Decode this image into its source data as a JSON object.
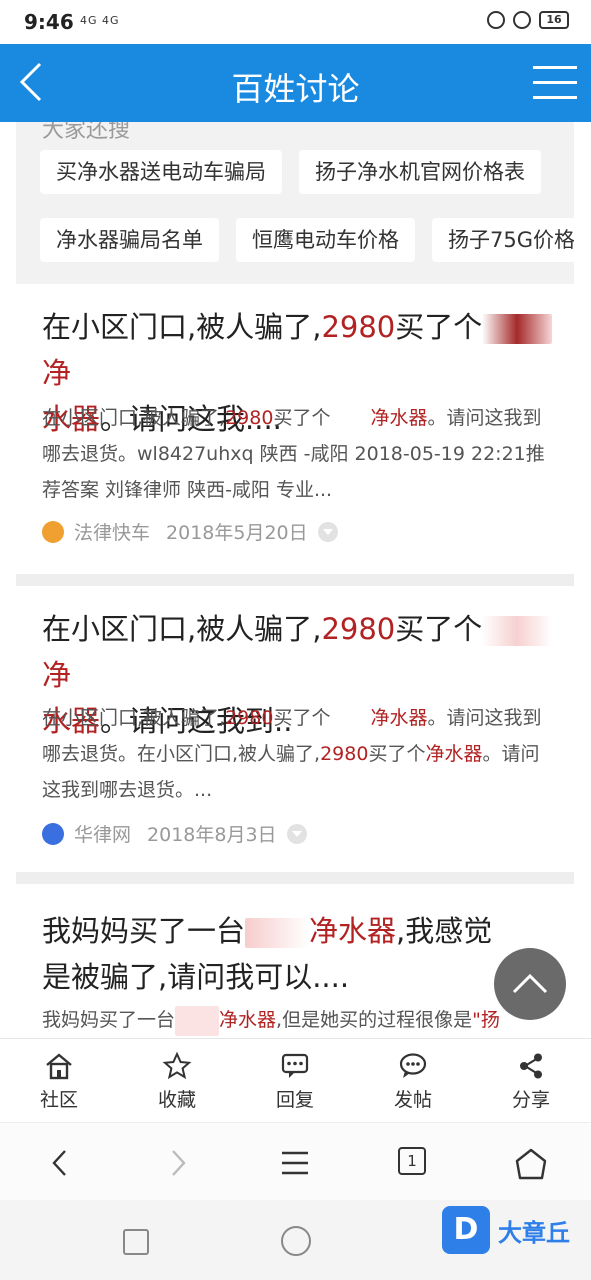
{
  "status_bar": {
    "time": "9:46",
    "signal": "4G 4G",
    "battery": "16"
  },
  "header": {
    "title": "百姓讨论"
  },
  "related": {
    "heading": "大家还搜",
    "chips": [
      "买净水器送电动车骗局",
      "扬子净水机官网价格表",
      "净水器骗局名单",
      "恒鹰电动车价格",
      "扬子75G价格"
    ]
  },
  "articles": [
    {
      "title": [
        "在小区门口,被人骗了,",
        "2980",
        "买了个",
        "净",
        "水器",
        "。请问这我...."
      ],
      "summary": [
        "在小区门口,被人骗了,",
        "2980",
        "买了个",
        "净水器",
        "。请问这我到哪去退货。wl8427uhxq 陕西 -咸阳 2018-05-19 22:21推荐答案 刘锋律师 陕西-咸阳 专业..."
      ],
      "source": "法律快车",
      "date": "2018年5月20日"
    },
    {
      "title": [
        "在小区门口,被人骗了,",
        "2980",
        "买了个",
        "净",
        "水器",
        "。请问这我到.."
      ],
      "summary": [
        "在小区门口,被人骗了,",
        "2980",
        "买了个",
        "净水器",
        "。请问这我到哪去退货。在小区门口,被人骗了,",
        "2980",
        "买了个",
        "净水器",
        "。请问这我到哪去退货。..."
      ],
      "source": "华律网",
      "date": "2018年8月3日"
    },
    {
      "title": [
        "我妈妈买了一台",
        "净水器",
        ",我感觉是被骗了,请问我可以...."
      ],
      "summary": [
        "我妈妈买了一台",
        "净水器",
        ",但是她买的过程很像是",
        "\"扬"
      ]
    }
  ],
  "tabbar": {
    "items": [
      "社区",
      "收藏",
      "回复",
      "发帖",
      "分享"
    ]
  },
  "browser": {
    "tab_count": "1"
  },
  "watermark": {
    "logo": "D",
    "text": "大章丘"
  },
  "colors": {
    "header_bg": "#1a8ae0",
    "highlight": "#b22222"
  },
  "icons": [
    "back-icon",
    "menu-icon",
    "home-icon",
    "star-icon",
    "reply-icon",
    "post-icon",
    "share-icon",
    "chevron-up-icon"
  ]
}
